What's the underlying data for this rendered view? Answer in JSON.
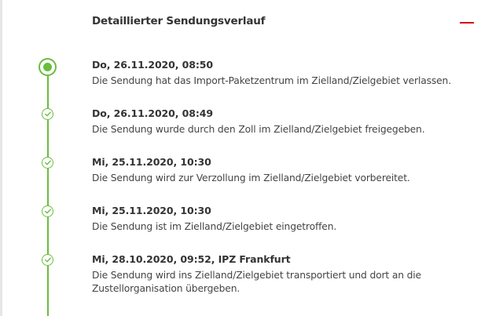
{
  "header": {
    "title": "Detaillierter Sendungsverlauf",
    "collapse_icon": "minus-icon"
  },
  "colors": {
    "accent": "#6abd3f",
    "collapse": "#d40511"
  },
  "events": [
    {
      "date": "Do, 26.11.2020, 08:50",
      "description": "Die Sendung hat das Import-Paketzentrum im Zielland/Zielgebiet verlassen.",
      "icon": "current-status-icon"
    },
    {
      "date": "Do, 26.11.2020, 08:49",
      "description": "Die Sendung wurde durch den Zoll im Zielland/Zielgebiet freigegeben.",
      "icon": "checkmark-icon"
    },
    {
      "date": "Mi, 25.11.2020, 10:30",
      "description": "Die Sendung wird zur Verzollung im Zielland/Zielgebiet vorbereitet.",
      "icon": "checkmark-icon"
    },
    {
      "date": "Mi, 25.11.2020, 10:30",
      "description": "Die Sendung ist im Zielland/Zielgebiet eingetroffen.",
      "icon": "checkmark-icon"
    },
    {
      "date": "Mi, 28.10.2020, 09:52, IPZ Frankfurt",
      "description": "Die Sendung wird ins Zielland/Zielgebiet transportiert und dort an die Zustellorganisation übergeben.",
      "icon": "checkmark-icon"
    }
  ]
}
